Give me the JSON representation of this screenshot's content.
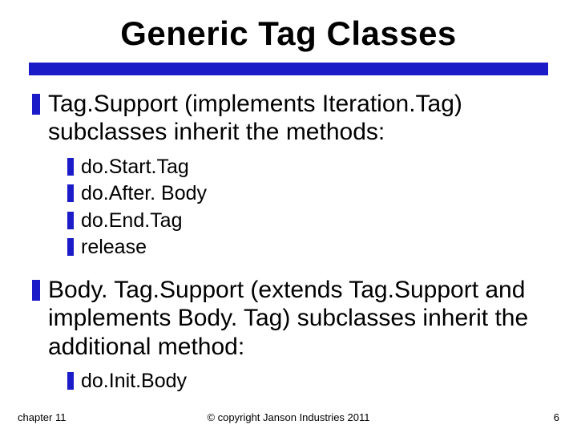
{
  "title": "Generic Tag Classes",
  "bullets": [
    {
      "text": "Tag.Support (implements Iteration.Tag) subclasses inherit the methods:",
      "children": [
        "do.Start.Tag",
        "do.After. Body",
        "do.End.Tag",
        "release"
      ]
    },
    {
      "text": "Body. Tag.Support (extends Tag.Support and implements Body. Tag) subclasses inherit the additional method:",
      "children": [
        "do.Init.Body"
      ]
    }
  ],
  "footer": {
    "left": "chapter 11",
    "center": "© copyright Janson Industries 2011",
    "right": "6"
  }
}
